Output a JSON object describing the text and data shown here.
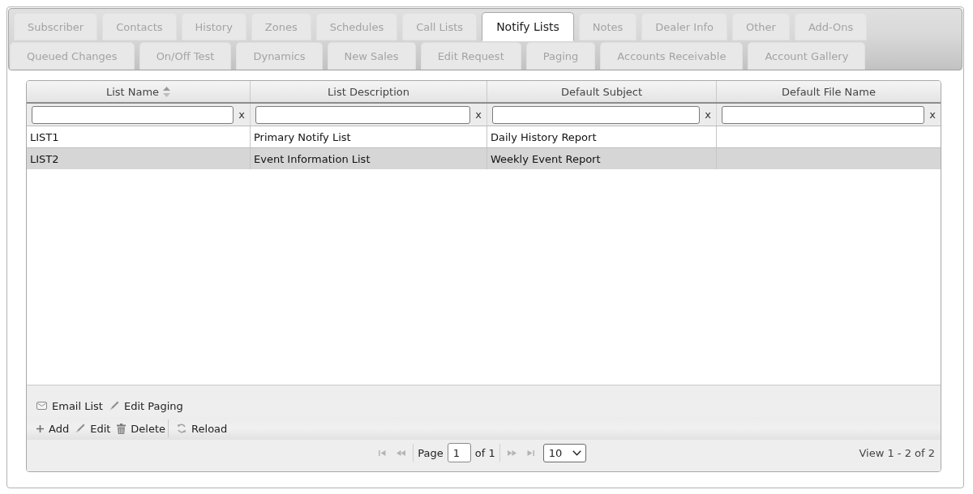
{
  "tab_rows": [
    {
      "tabs": [
        {
          "label": "Subscriber",
          "selected": false
        },
        {
          "label": "Contacts",
          "selected": false
        },
        {
          "label": "History",
          "selected": false
        },
        {
          "label": "Zones",
          "selected": false
        },
        {
          "label": "Schedules",
          "selected": false
        },
        {
          "label": "Call Lists",
          "selected": false
        },
        {
          "label": "Notify Lists",
          "selected": true
        },
        {
          "label": "Notes",
          "selected": false
        },
        {
          "label": "Dealer Info",
          "selected": false
        },
        {
          "label": "Other",
          "selected": false
        },
        {
          "label": "Add-Ons",
          "selected": false
        }
      ]
    },
    {
      "tabs": [
        {
          "label": "Queued Changes",
          "selected": false
        },
        {
          "label": "On/Off Test",
          "selected": false
        },
        {
          "label": "Dynamics",
          "selected": false
        },
        {
          "label": "New Sales",
          "selected": false
        },
        {
          "label": "Edit Request",
          "selected": false
        },
        {
          "label": "Paging",
          "selected": false
        },
        {
          "label": "Accounts Receivable",
          "selected": false
        },
        {
          "label": "Account Gallery",
          "selected": false
        }
      ]
    }
  ],
  "grid": {
    "columns": [
      {
        "label": "List Name",
        "sorted": true
      },
      {
        "label": "List Description",
        "sorted": false
      },
      {
        "label": "Default Subject",
        "sorted": false
      },
      {
        "label": "Default File Name",
        "sorted": false
      }
    ],
    "filters": [
      {
        "clear": "x"
      },
      {
        "clear": "x"
      },
      {
        "clear": "x"
      },
      {
        "clear": "x"
      }
    ],
    "rows": [
      {
        "cells": [
          "LIST1",
          "Primary Notify List",
          "Daily History Report"
        ],
        "selected": false
      },
      {
        "cells": [
          "LIST2",
          "Event Information List",
          "Weekly Event Report"
        ],
        "selected": true
      }
    ]
  },
  "toolbar_rows": [
    {
      "groups": [
        {
          "buttons": [
            {
              "kind": "mail",
              "label": "Email List"
            },
            {
              "kind": "pencil",
              "label": "Edit Paging"
            }
          ]
        }
      ]
    },
    {
      "groups": [
        {
          "buttons": [
            {
              "kind": "plus",
              "label": "Add"
            },
            {
              "kind": "pencil",
              "label": "Edit"
            },
            {
              "kind": "trash",
              "label": "Delete"
            }
          ]
        },
        {
          "buttons": [
            {
              "kind": "refresh",
              "label": "Reload"
            }
          ]
        }
      ]
    }
  ],
  "pager": {
    "nav_back": [
      {
        "kind": "first",
        "disabled": true
      },
      {
        "kind": "prev",
        "disabled": true
      }
    ],
    "page_label": "Page",
    "page": "1",
    "total_label": "of 1",
    "nav_forward": [
      {
        "kind": "next",
        "disabled": true
      },
      {
        "kind": "last",
        "disabled": true
      }
    ],
    "page_size": "10",
    "record_count": "View 1 - 2 of 2"
  }
}
